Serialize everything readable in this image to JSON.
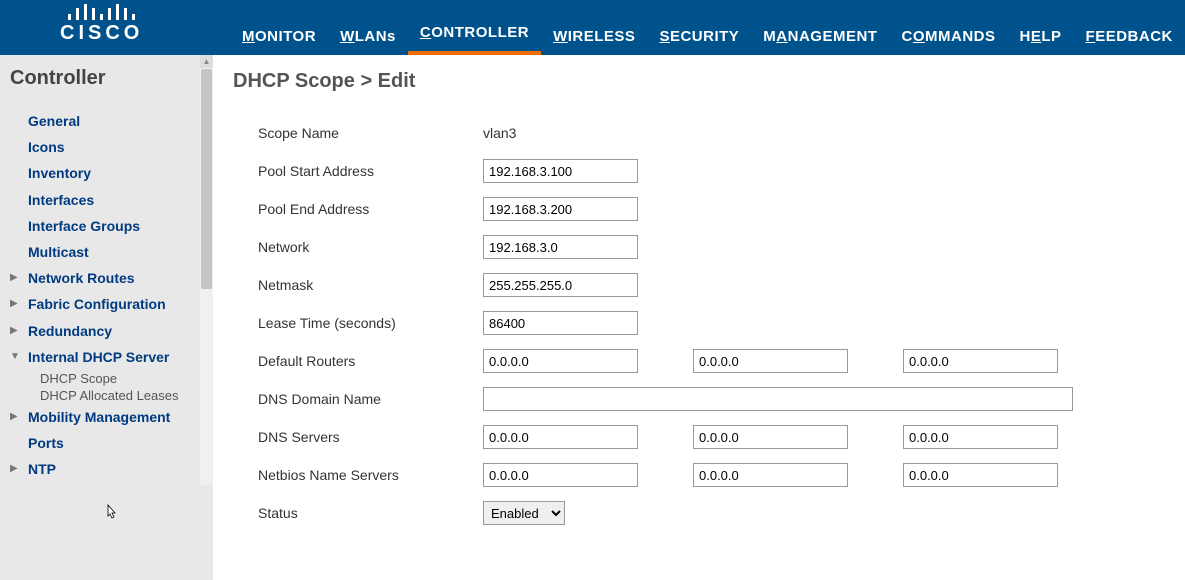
{
  "logo": "CISCO",
  "nav": [
    {
      "label": "MONITOR",
      "u": "M"
    },
    {
      "label": "WLANs",
      "u": "W"
    },
    {
      "label": "CONTROLLER",
      "u": "C",
      "active": true
    },
    {
      "label": "WIRELESS",
      "u": "W"
    },
    {
      "label": "SECURITY",
      "u": "S"
    },
    {
      "label": "MANAGEMENT",
      "u": "A"
    },
    {
      "label": "COMMANDS",
      "u": "O"
    },
    {
      "label": "HELP",
      "u": "E"
    },
    {
      "label": "FEEDBACK",
      "u": "F"
    }
  ],
  "sidebar": {
    "title": "Controller",
    "items": [
      {
        "label": "General",
        "arrow": ""
      },
      {
        "label": "Icons",
        "arrow": ""
      },
      {
        "label": "Inventory",
        "arrow": ""
      },
      {
        "label": "Interfaces",
        "arrow": ""
      },
      {
        "label": "Interface Groups",
        "arrow": ""
      },
      {
        "label": "Multicast",
        "arrow": ""
      },
      {
        "label": "Network Routes",
        "arrow": "▶"
      },
      {
        "label": "Fabric Configuration",
        "arrow": "▶"
      },
      {
        "label": "Redundancy",
        "arrow": "▶"
      },
      {
        "label": "Internal DHCP Server",
        "arrow": "▼",
        "children": [
          "DHCP Scope",
          "DHCP Allocated Leases"
        ]
      },
      {
        "label": "Mobility Management",
        "arrow": "▶"
      },
      {
        "label": "Ports",
        "arrow": ""
      },
      {
        "label": "NTP",
        "arrow": "▶"
      }
    ]
  },
  "page": {
    "title": "DHCP Scope > Edit",
    "scope_name_label": "Scope Name",
    "scope_name_value": "vlan3",
    "pool_start_label": "Pool Start Address",
    "pool_start_value": "192.168.3.100",
    "pool_end_label": "Pool End Address",
    "pool_end_value": "192.168.3.200",
    "network_label": "Network",
    "network_value": "192.168.3.0",
    "netmask_label": "Netmask",
    "netmask_value": "255.255.255.0",
    "lease_label": "Lease Time (seconds)",
    "lease_value": "86400",
    "routers_label": "Default Routers",
    "routers": [
      "0.0.0.0",
      "0.0.0.0",
      "0.0.0.0"
    ],
    "dns_domain_label": "DNS Domain Name",
    "dns_domain_value": "",
    "dns_servers_label": "DNS Servers",
    "dns_servers": [
      "0.0.0.0",
      "0.0.0.0",
      "0.0.0.0"
    ],
    "netbios_label": "Netbios Name Servers",
    "netbios": [
      "0.0.0.0",
      "0.0.0.0",
      "0.0.0.0"
    ],
    "status_label": "Status",
    "status_value": "Enabled"
  }
}
